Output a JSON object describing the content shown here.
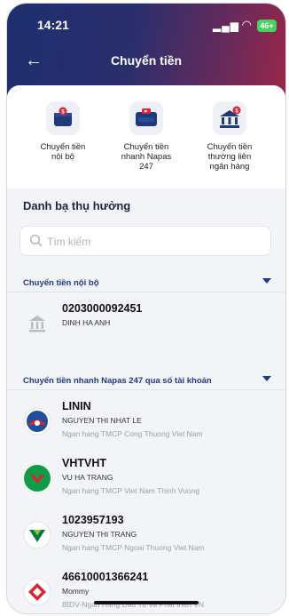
{
  "status_bar": {
    "time": "14:21",
    "battery": "46+"
  },
  "header": {
    "title": "Chuyển tiền"
  },
  "quick_actions": [
    {
      "label_lines": [
        "Chuyển tiền",
        "nội bộ"
      ],
      "icon": "internal-transfer-icon"
    },
    {
      "label_lines": [
        "Chuyển tiền",
        "nhanh Napas",
        "247"
      ],
      "icon": "napas-card-icon"
    },
    {
      "label_lines": [
        "Chuyển tiền",
        "thường liên",
        "ngân hàng"
      ],
      "icon": "bank-building-icon"
    }
  ],
  "directory": {
    "title": "Danh bạ thụ hưởng",
    "search_placeholder": "Tìm kiếm"
  },
  "groups": [
    {
      "title": "Chuyển tiền nội bộ",
      "items": [
        {
          "account": "0203000092451",
          "name": "DINH HA ANH",
          "bank": "",
          "logo": "bank-gray-icon"
        }
      ]
    },
    {
      "title": "Chuyển tiền nhanh Napas 247 qua số tài khoản",
      "items": [
        {
          "account": "LININ",
          "name": "NGUYEN THI NHAT LE",
          "bank": "Ngan hang TMCP Cong Thuong Viet Nam",
          "logo": "vietinbank-logo"
        },
        {
          "account": "VHTVHT",
          "name": "VU HA TRANG",
          "bank": "Ngan hang TMCP Viet Nam Thinh Vuong",
          "logo": "vpbank-logo"
        },
        {
          "account": "1023957193",
          "name": "NGUYEN THI TRANG",
          "bank": "Ngan hang TMCP Ngoai Thuong Viet Nam",
          "logo": "vietcombank-logo"
        },
        {
          "account": "46610001366241",
          "name": "Mommy",
          "bank": "BIDV-Ngan Hang Dau Tu Va Phat trien VN",
          "logo": "bidv-logo"
        }
      ]
    }
  ],
  "colors": {
    "header_start": "#1e2f6e",
    "header_end": "#9a2648",
    "accent": "#1f3a86"
  }
}
